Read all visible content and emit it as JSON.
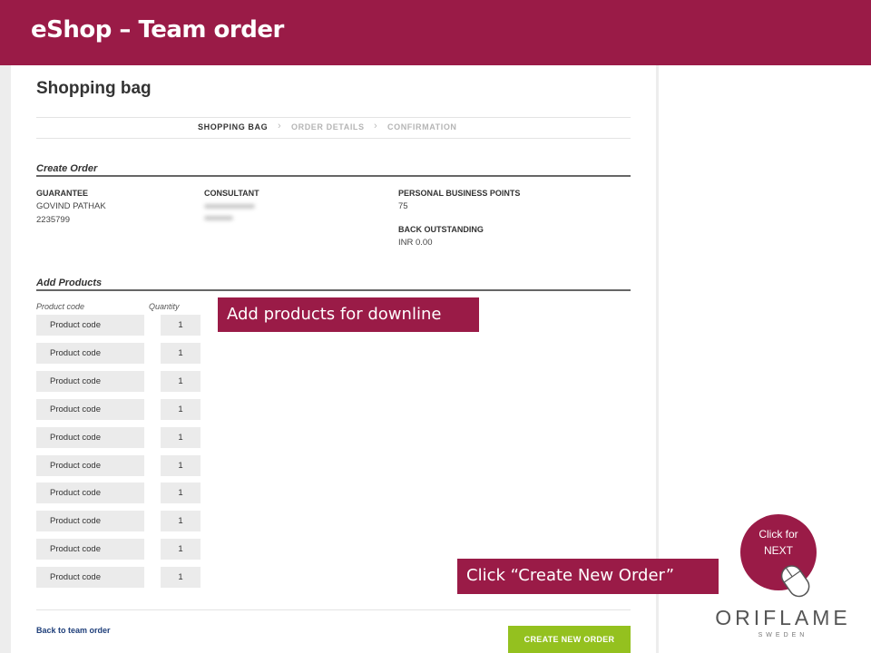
{
  "slide": {
    "title": "eShop – Team order"
  },
  "page": {
    "title": "Shopping bag",
    "steps": [
      "SHOPPING BAG",
      "ORDER DETAILS",
      "CONFIRMATION"
    ]
  },
  "create_order": {
    "section_title": "Create Order",
    "guarantee_label": "GUARANTEE",
    "guarantee_name": "GOVIND PATHAK",
    "guarantee_id": "2235799",
    "consultant_label": "CONSULTANT",
    "pbp_label": "PERSONAL BUSINESS POINTS",
    "pbp_value": "75",
    "back_outstanding_label": "BACK OUTSTANDING",
    "back_outstanding_value": "INR 0.00"
  },
  "add_products": {
    "section_title": "Add Products",
    "col_code": "Product code",
    "col_qty": "Quantity",
    "rows": [
      {
        "code": "Product code",
        "qty": "1"
      },
      {
        "code": "Product code",
        "qty": "1"
      },
      {
        "code": "Product code",
        "qty": "1"
      },
      {
        "code": "Product code",
        "qty": "1"
      },
      {
        "code": "Product code",
        "qty": "1"
      },
      {
        "code": "Product code",
        "qty": "1"
      },
      {
        "code": "Product code",
        "qty": "1"
      },
      {
        "code": "Product code",
        "qty": "1"
      },
      {
        "code": "Product code",
        "qty": "1"
      },
      {
        "code": "Product code",
        "qty": "1"
      }
    ]
  },
  "footer": {
    "back_link": "Back to team order",
    "create_button": "CREATE NEW ORDER"
  },
  "callouts": {
    "add_products": "Add products for downline",
    "create_order": "Click “Create New Order”"
  },
  "next": {
    "line1": "Click for",
    "line2": "NEXT"
  },
  "brand": {
    "name": "ORIFLAME",
    "sub": "SWEDEN"
  },
  "colors": {
    "brand": "#9a1b47",
    "button_green": "#94c11f"
  }
}
